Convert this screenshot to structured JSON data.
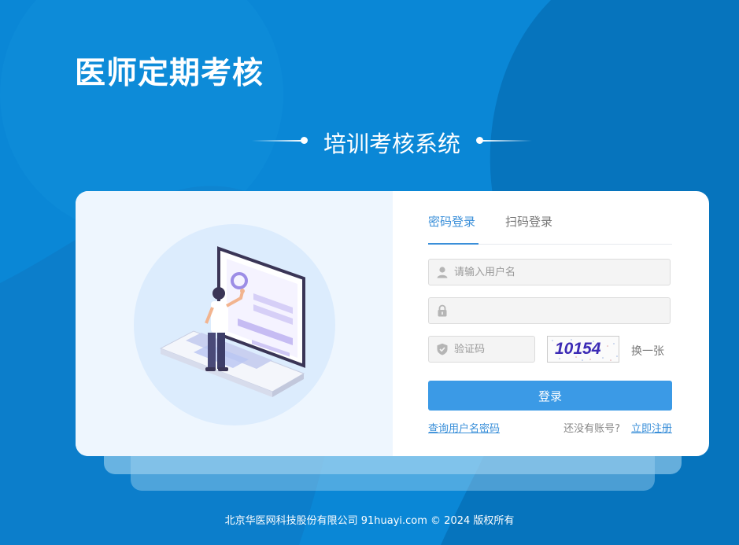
{
  "header": {
    "app_title": "医师定期考核",
    "subtitle": "培训考核系统"
  },
  "login": {
    "tabs": [
      {
        "label": "密码登录",
        "active": true
      },
      {
        "label": "扫码登录",
        "active": false
      }
    ],
    "username_placeholder": "请输入用户名",
    "username_value": "",
    "password_value": "",
    "captcha_placeholder": "验证码",
    "captcha_image_text": "10154",
    "refresh_label": "换一张",
    "submit_label": "登录",
    "find_account_label": "查询用户名密码",
    "no_account_text": "还没有账号?",
    "register_label": "立即注册"
  },
  "footer": {
    "text": "北京华医网科技股份有限公司 91huayi.com © 2024 版权所有"
  },
  "colors": {
    "background": "#0a87d6",
    "accent": "#3b9ae6",
    "link": "#3a8fd9"
  },
  "icons": {
    "username": "user-icon",
    "password": "lock-icon",
    "captcha": "shield-icon"
  }
}
